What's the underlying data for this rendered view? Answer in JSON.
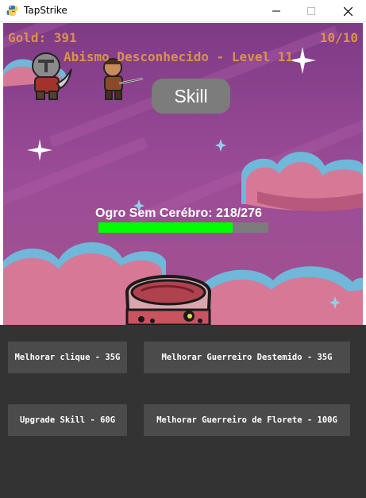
{
  "window": {
    "title": "TapStrike"
  },
  "hud": {
    "gold": "Gold: 391",
    "wave": "10/10",
    "level": "Abismo Desconhecido - Level 11"
  },
  "skill": {
    "label": "Skill"
  },
  "boss": {
    "name_hp": "Ogro Sem Cerébro: 218/276",
    "hp": 218,
    "max_hp": 276,
    "hp_color": "#00ff00"
  },
  "upgrades": {
    "click": "Melhorar clique - 35G",
    "warrior": "Melhorar Guerreiro Destemido - 35G",
    "skill": "Upgrade Skill - 60G",
    "fencer": "Melhorar Guerreiro de Florete - 100G"
  },
  "colors": {
    "sky": "#8e3f8e",
    "hud_text": "#d8934a",
    "panel": "#333333",
    "button": "#4b4b4b"
  },
  "icons": {
    "app": "python-icon",
    "minimize": "minimize-icon",
    "maximize": "maximize-icon",
    "close": "close-icon"
  }
}
